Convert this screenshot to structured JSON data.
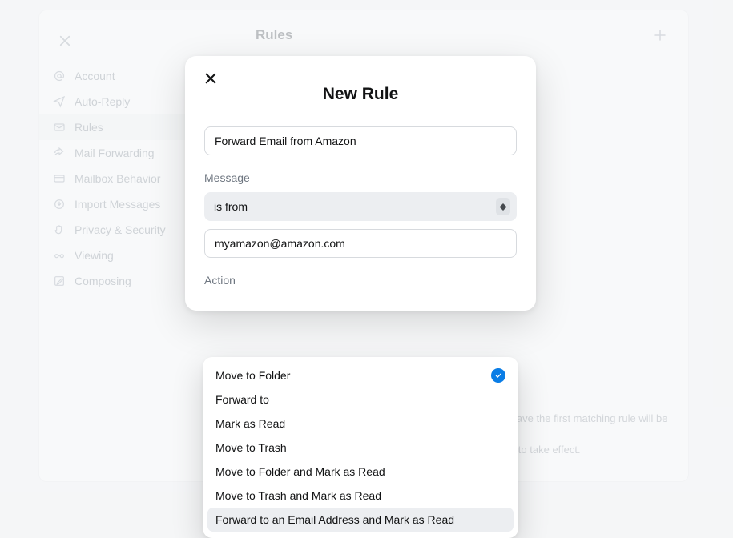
{
  "sidebar": {
    "items": [
      {
        "label": "Account",
        "icon": "at"
      },
      {
        "label": "Auto-Reply",
        "icon": "paper-plane"
      },
      {
        "label": "Rules",
        "icon": "rules"
      },
      {
        "label": "Mail Forwarding",
        "icon": "forward"
      },
      {
        "label": "Mailbox Behavior",
        "icon": "mailbox"
      },
      {
        "label": "Import Messages",
        "icon": "import"
      },
      {
        "label": "Privacy & Security",
        "icon": "hand"
      },
      {
        "label": "Viewing",
        "icon": "glasses"
      },
      {
        "label": "Composing",
        "icon": "compose"
      }
    ],
    "selected_index": 2
  },
  "main": {
    "title": "Rules",
    "footer_line1": "New messages that match more than one rule will only have the first matching rule will be applied",
    "footer_line2": "to them. Tap or click Done after making changes to rules to take effect."
  },
  "modal": {
    "title": "New Rule",
    "name_value": "Forward Email from Amazon",
    "message_label": "Message",
    "condition_select": "is from",
    "condition_value": "myamazon@amazon.com",
    "action_label": "Action"
  },
  "dropdown": {
    "selected_index": 0,
    "hover_index": 6,
    "options": [
      "Move to Folder",
      "Forward to",
      "Mark as Read",
      "Move to Trash",
      "Move to Folder and Mark as Read",
      "Move to Trash and Mark as Read",
      "Forward to an Email Address and Mark as Read"
    ]
  }
}
